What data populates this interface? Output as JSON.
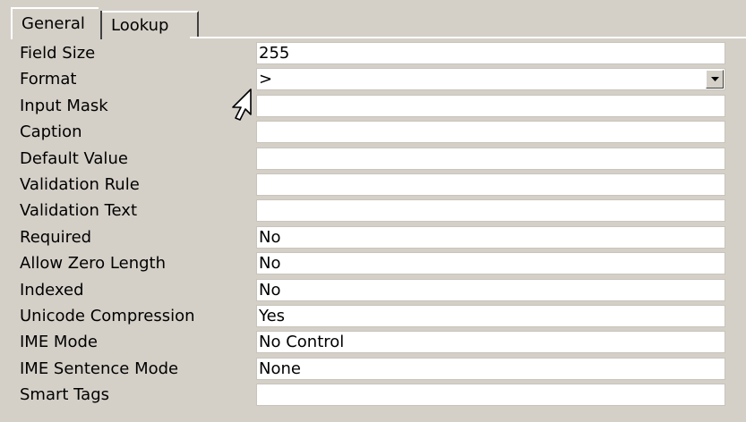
{
  "tabs": [
    "General",
    "Lookup"
  ],
  "properties": [
    {
      "label": "Field Size",
      "value": "255"
    },
    {
      "label": "Format",
      "value": ">"
    },
    {
      "label": "Input Mask",
      "value": ""
    },
    {
      "label": "Caption",
      "value": ""
    },
    {
      "label": "Default Value",
      "value": ""
    },
    {
      "label": "Validation Rule",
      "value": ""
    },
    {
      "label": "Validation Text",
      "value": ""
    },
    {
      "label": "Required",
      "value": "No"
    },
    {
      "label": "Allow Zero Length",
      "value": "No"
    },
    {
      "label": "Indexed",
      "value": "No"
    },
    {
      "label": "Unicode Compression",
      "value": "Yes"
    },
    {
      "label": "IME Mode",
      "value": "No Control"
    },
    {
      "label": "IME Sentence Mode",
      "value": "None"
    },
    {
      "label": "Smart Tags",
      "value": ""
    }
  ],
  "icons": {
    "dropdown": "dropdown-arrow-icon",
    "cursor": "mouse-pointer-icon"
  }
}
